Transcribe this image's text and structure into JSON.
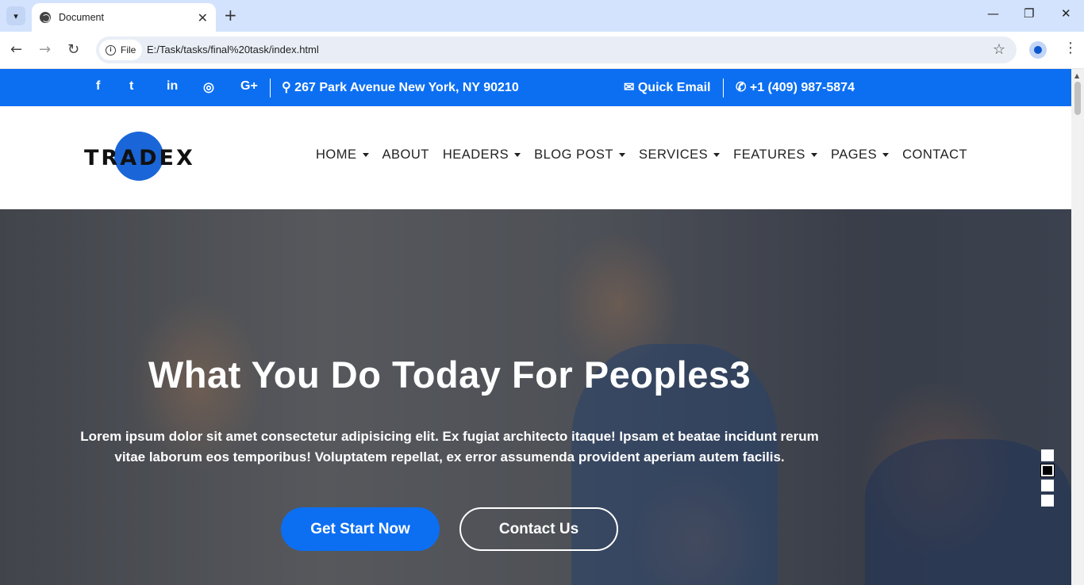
{
  "browser": {
    "tab_title": "Document",
    "url_chip": "File",
    "url": "E:/Task/tasks/final%20task/index.html"
  },
  "topbar": {
    "social": [
      "f",
      "t",
      "in",
      "◎",
      "G+"
    ],
    "address": "267 Park Avenue New York, NY 90210",
    "email": "Quick Email",
    "phone": "+1 (409) 987-5874"
  },
  "header": {
    "logo_text": "TRADEX",
    "nav": [
      {
        "label": "HOME",
        "dropdown": true
      },
      {
        "label": "ABOUT",
        "dropdown": false
      },
      {
        "label": "HEADERS",
        "dropdown": true
      },
      {
        "label": "BLOG POST",
        "dropdown": true
      },
      {
        "label": "SERVICES",
        "dropdown": true
      },
      {
        "label": "FEATURES",
        "dropdown": true
      },
      {
        "label": "PAGES",
        "dropdown": true
      },
      {
        "label": "CONTACT",
        "dropdown": false
      }
    ]
  },
  "hero": {
    "title": "What You Do Today For Peoples3",
    "text": "Lorem ipsum dolor sit amet consectetur adipisicing elit. Ex fugiat architecto itaque! Ipsam et beatae incidunt rerum vitae laborum eos temporibus! Voluptatem repellat, ex error assumenda provident aperiam autem facilis.",
    "primary_button": "Get Start Now",
    "secondary_button": "Contact Us",
    "slide_count": 4,
    "active_slide": 2
  },
  "colors": {
    "brand": "#0c6ff2",
    "chrome_tabbar": "#d3e3fd"
  }
}
